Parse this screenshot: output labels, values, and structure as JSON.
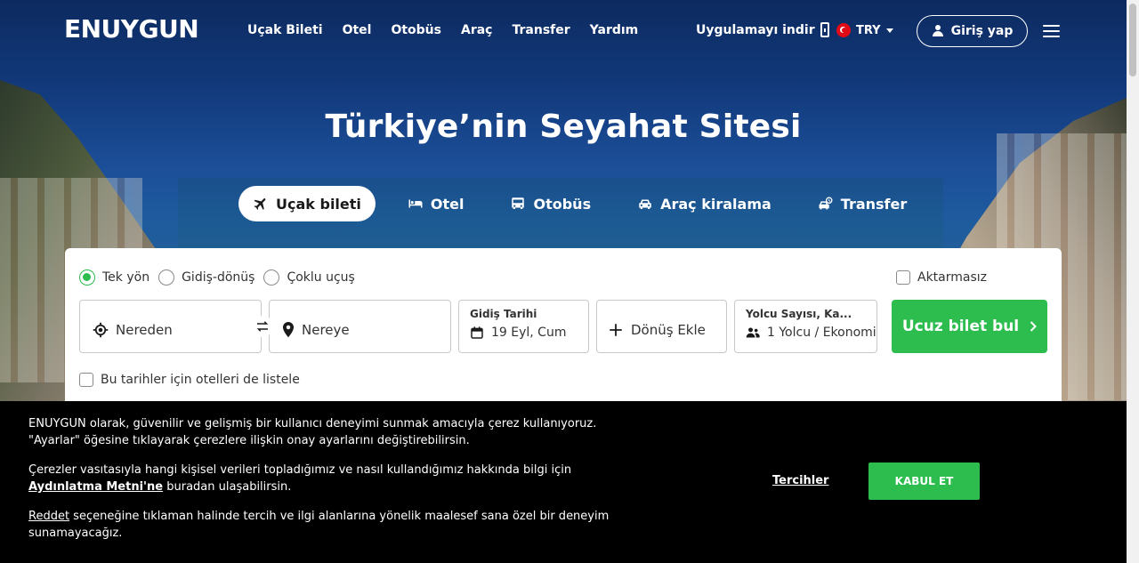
{
  "header": {
    "logo": "ENUYGUN",
    "nav": [
      "Uçak Bileti",
      "Otel",
      "Otobüs",
      "Araç",
      "Transfer",
      "Yardım"
    ],
    "app_download": "Uygulamayı indir",
    "currency": "TRY",
    "login": "Giriş yap"
  },
  "hero": {
    "title": "Türkiye’nin Seyahat Sitesi"
  },
  "tabs": [
    {
      "label": "Uçak bileti",
      "icon": "plane-icon",
      "active": true
    },
    {
      "label": "Otel",
      "icon": "bed-icon",
      "active": false
    },
    {
      "label": "Otobüs",
      "icon": "bus-icon",
      "active": false
    },
    {
      "label": "Araç kiralama",
      "icon": "car-icon",
      "active": false
    },
    {
      "label": "Transfer",
      "icon": "transfer-icon",
      "active": false
    }
  ],
  "search": {
    "trip_types": [
      {
        "label": "Tek yön",
        "checked": true
      },
      {
        "label": "Gidiş-dönüş",
        "checked": false
      },
      {
        "label": "Çoklu uçuş",
        "checked": false
      }
    ],
    "nonstop_label": "Aktarmasız",
    "from_placeholder": "Nereden",
    "to_placeholder": "Nereye",
    "departure_label": "Gidiş Tarihi",
    "departure_value": "19 Eyl, Cum",
    "return_label": "Dönüş Ekle",
    "passenger_label": "Yolcu Sayısı, Ka...",
    "passenger_value": "1 Yolcu / Ekonomi",
    "submit_label": "Ucuz bilet bul",
    "hotel_checkbox_label": "Bu tarihler için otelleri de listele"
  },
  "cookie": {
    "p1": "ENUYGUN olarak, güvenilir ve gelişmiş bir kullanıcı deneyimi sunmak amacıyla çerez kullanıyoruz. \"Ayarlar\" öğesine tıklayarak çerezlere ilişkin onay ayarlarını değiştirebilirsin.",
    "p2_pre": "Çerezler vasıtasıyla hangi kişisel verileri topladığımız ve nasıl kullandığımız hakkında bilgi için ",
    "p2_link": "Aydınlatma Metni'ne",
    "p2_post": " buradan ulaşabilirsin.",
    "p3_link": "Reddet",
    "p3_post": " seçeneğine tıklaman halinde tercih ve ilgi alanlarına yönelik maalesef sana özel bir deneyim sunamayacağız.",
    "preferences": "Tercihler",
    "accept": "KABUL ET"
  },
  "colors": {
    "accent_green": "#2dbd4e",
    "banner_bg": "#000000"
  }
}
